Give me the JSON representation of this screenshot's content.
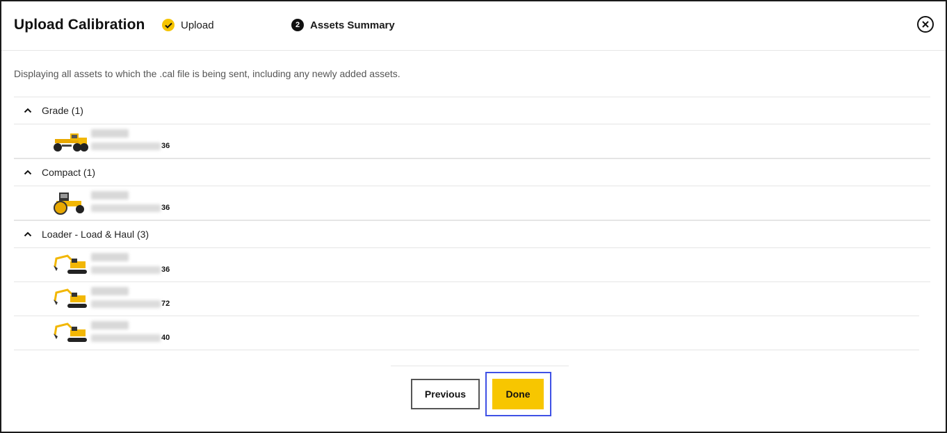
{
  "dialog": {
    "title": "Upload Calibration",
    "steps": [
      {
        "label": "Upload",
        "status": "done"
      },
      {
        "number": "2",
        "label": "Assets Summary",
        "status": "active"
      }
    ],
    "close_icon": "close-circle-icon"
  },
  "description": "Displaying all assets to which the .cal file is being sent, including any newly added assets.",
  "groups": [
    {
      "label": "Grade (1)",
      "assets": [
        {
          "icon": "grader-icon",
          "suffix": "36"
        }
      ]
    },
    {
      "label": "Compact (1)",
      "assets": [
        {
          "icon": "compactor-icon",
          "suffix": "36"
        }
      ]
    },
    {
      "label": "Loader - Load & Haul (3)",
      "assets": [
        {
          "icon": "excavator-icon",
          "suffix": "36"
        },
        {
          "icon": "excavator-icon",
          "suffix": "72"
        },
        {
          "icon": "excavator-icon",
          "suffix": "40"
        }
      ]
    }
  ],
  "footer": {
    "previous_label": "Previous",
    "done_label": "Done"
  },
  "colors": {
    "accent": "#f7c600",
    "focus": "#3f51e5"
  }
}
